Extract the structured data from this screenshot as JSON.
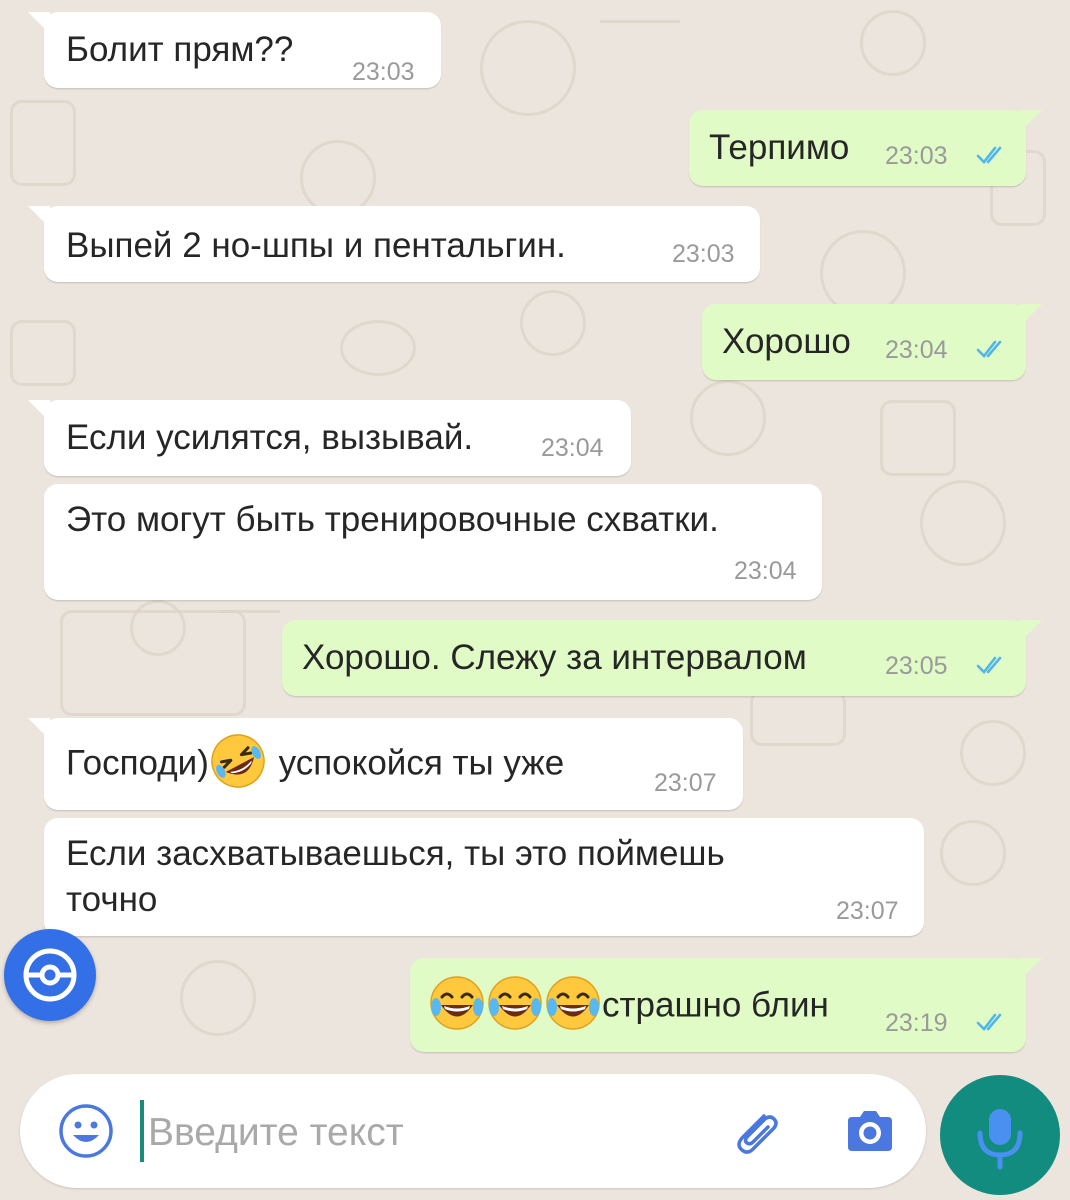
{
  "messages": [
    {
      "dir": "in",
      "text": "Болит прям??",
      "time": "23:03"
    },
    {
      "dir": "out",
      "text": "Терпимо",
      "time": "23:03"
    },
    {
      "dir": "in",
      "text": "Выпей 2 но-шпы и пентальгин.",
      "time": "23:03"
    },
    {
      "dir": "out",
      "text": "Хорошо",
      "time": "23:04"
    },
    {
      "dir": "in",
      "text": "Если усилятся, вызывай.",
      "time": "23:04"
    },
    {
      "dir": "in",
      "text": "Это могут быть тренировочные схватки.",
      "time": "23:04"
    },
    {
      "dir": "out",
      "text": "Хорошо. Слежу за интервалом",
      "time": "23:05"
    },
    {
      "dir": "in",
      "text_before": "Господи)",
      "emoji": "rolling-on-floor-laughing",
      "text_after": " успокойся ты уже",
      "time": "23:07"
    },
    {
      "dir": "in",
      "lines": [
        "Если засхватываешься, ты это поймешь",
        "точно"
      ],
      "time": "23:07"
    },
    {
      "dir": "out",
      "emojis": [
        "tears-of-joy",
        "tears-of-joy",
        "tears-of-joy"
      ],
      "text": "страшно блин",
      "time": "23:19"
    }
  ],
  "input": {
    "placeholder": "Введите текст"
  },
  "icons": {
    "emoji_button": "smiley-icon",
    "attach": "paperclip-icon",
    "camera": "camera-icon",
    "mic": "microphone-icon",
    "floating": "pokeball-icon",
    "read_receipt": "double-check-icon"
  },
  "colors": {
    "incoming_bubble": "#FFFFFF",
    "outgoing_bubble": "#E1FBC7",
    "chat_background": "#ECE5DD",
    "accent_green": "#128C7E",
    "read_tick_blue": "#4FB6EC",
    "floating_button_blue": "#3370E8"
  }
}
